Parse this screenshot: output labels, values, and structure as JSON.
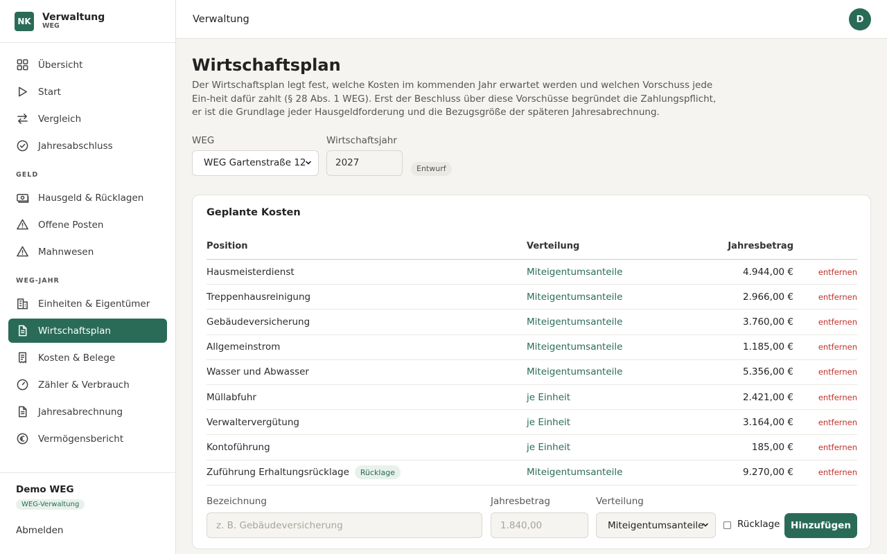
{
  "brand": {
    "logo": "NK",
    "title": "Verwaltung",
    "subtitle": "WEG"
  },
  "nav": {
    "top": [
      {
        "label": "Übersicht",
        "icon": "grid-icon"
      },
      {
        "label": "Start",
        "icon": "play-icon"
      },
      {
        "label": "Vergleich",
        "icon": "swap-icon"
      },
      {
        "label": "Jahresabschluss",
        "icon": "check-circle-icon"
      }
    ],
    "section_geld": "GELD",
    "geld": [
      {
        "label": "Hausgeld & Rücklagen",
        "icon": "banknote-icon"
      },
      {
        "label": "Offene Posten",
        "icon": "warning-icon"
      },
      {
        "label": "Mahnwesen",
        "icon": "warning-icon"
      }
    ],
    "section_weg": "WEG-JAHR",
    "weg": [
      {
        "label": "Einheiten & Eigentümer",
        "icon": "building-icon"
      },
      {
        "label": "Wirtschaftsplan",
        "icon": "document-icon",
        "active": true
      },
      {
        "label": "Kosten & Belege",
        "icon": "receipt-icon"
      },
      {
        "label": "Zähler & Verbrauch",
        "icon": "gauge-icon"
      },
      {
        "label": "Jahresabrechnung",
        "icon": "document-icon"
      },
      {
        "label": "Vermögensbericht",
        "icon": "euro-icon"
      }
    ]
  },
  "footer": {
    "org_name": "Demo WEG",
    "org_badge": "WEG-Verwaltung",
    "logout": "Abmelden"
  },
  "topbar": {
    "title": "Verwaltung",
    "avatar": "D"
  },
  "page": {
    "title": "Wirtschaftsplan",
    "description": "Der Wirtschaftsplan legt fest, welche Kosten im kommenden Jahr erwartet werden und welchen Vorschuss jede Ein-heit dafür zahlt (§ 28 Abs. 1 WEG). Erst der Beschluss über diese Vorschüsse begründet die Zahlungspflicht, er ist die Grundlage jeder Hausgeldforderung und die Bezugsgröße der späteren Jahresabrechnung."
  },
  "filters": {
    "weg_label": "WEG",
    "weg_value": "WEG Gartenstraße 12",
    "year_label": "Wirtschaftsjahr",
    "year_value": "2027",
    "status_badge": "Entwurf"
  },
  "card": {
    "title": "Geplante Kosten",
    "headers": {
      "position": "Position",
      "verteilung": "Verteilung",
      "betrag": "Jahresbetrag"
    },
    "remove_label": "entfernen",
    "rows": [
      {
        "position": "Hausmeisterdienst",
        "verteilung": "Miteigentumsanteile",
        "betrag": "4.944,00 €"
      },
      {
        "position": "Treppenhausreinigung",
        "verteilung": "Miteigentumsanteile",
        "betrag": "2.966,00 €"
      },
      {
        "position": "Gebäudeversicherung",
        "verteilung": "Miteigentumsanteile",
        "betrag": "3.760,00 €"
      },
      {
        "position": "Allgemeinstrom",
        "verteilung": "Miteigentumsanteile",
        "betrag": "1.185,00 €"
      },
      {
        "position": "Wasser und Abwasser",
        "verteilung": "Miteigentumsanteile",
        "betrag": "5.356,00 €"
      },
      {
        "position": "Müllabfuhr",
        "verteilung": "je Einheit",
        "betrag": "2.421,00 €"
      },
      {
        "position": "Verwaltervergütung",
        "verteilung": "je Einheit",
        "betrag": "3.164,00 €"
      },
      {
        "position": "Kontoführung",
        "verteilung": "je Einheit",
        "betrag": "185,00 €"
      },
      {
        "position": "Zuführung Erhaltungsrücklage",
        "verteilung": "Miteigentumsanteile",
        "betrag": "9.270,00 €",
        "badge": "Rücklage"
      }
    ]
  },
  "form": {
    "bezeichnung_label": "Bezeichnung",
    "bezeichnung_placeholder": "z. B. Gebäudeversicherung",
    "betrag_label": "Jahresbetrag",
    "betrag_placeholder": "1.840,00",
    "verteilung_label": "Verteilung",
    "verteilung_value": "Miteigentumsanteile",
    "ruecklage_label": "Rücklage",
    "submit_label": "Hinzufügen"
  },
  "colors": {
    "accent": "#2a6b57",
    "danger": "#c0322b",
    "background": "#f5f4f0"
  }
}
